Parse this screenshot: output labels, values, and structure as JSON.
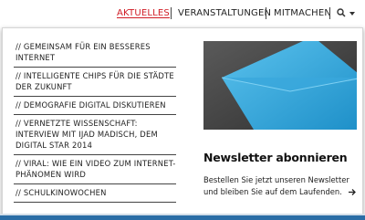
{
  "nav": {
    "items": [
      {
        "label": "AKTUELLES",
        "active": true
      },
      {
        "label": "VERANSTALTUNGEN",
        "active": false
      },
      {
        "label": "MITMACHEN",
        "active": false
      }
    ],
    "search_icon": "search-icon",
    "caret_icon": "chevron-down-icon",
    "active_color": "#d01c25"
  },
  "dropdown": {
    "articles": [
      "// GEMEINSAM FÜR EIN BESSERES INTERNET",
      "// INTELLIGENTE CHIPS FÜR DIE STÄDTE DER ZUKUNFT",
      "// DEMOGRAFIE DIGITAL DISKUTIEREN",
      "// VERNETZTE WISSENSCHAFT: INTERVIEW MIT IJAD MADISCH, DEM DIGITAL STAR 2014",
      "// VIRAL: WIE EIN VIDEO ZUM INTERNET-PHÄNOMEN WIRD",
      "// SCHULKINOWOCHEN"
    ],
    "promo": {
      "title": "Newsletter abonnieren",
      "text": "Bestellen Sie jetzt unseren Newsletter und bleiben Sie auf dem Laufenden.",
      "arrow_icon": "arrow-right-icon",
      "image": "envelope-image",
      "image_color": "#2aa3dd"
    }
  }
}
